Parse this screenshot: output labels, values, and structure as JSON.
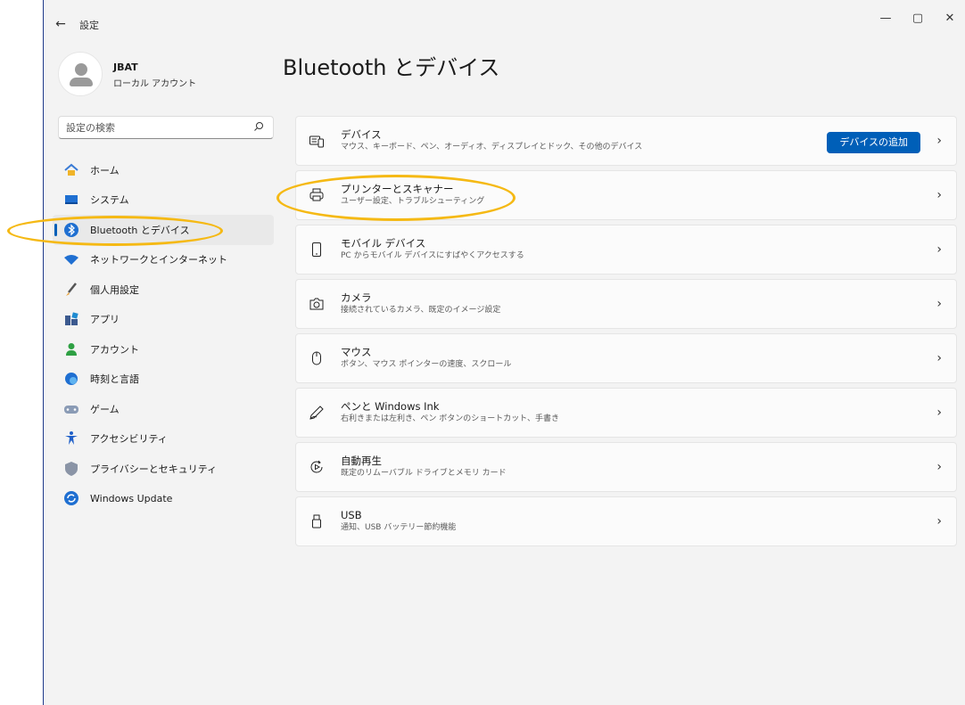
{
  "window": {
    "title": "設定",
    "controls": {
      "minimize": "—",
      "maximize": "▢",
      "close": "✕"
    }
  },
  "profile": {
    "name": "JBAT",
    "account_type": "ローカル アカウント"
  },
  "search": {
    "placeholder": "設定の検索"
  },
  "sidebar": {
    "items": [
      {
        "label": "ホーム",
        "icon": "home-icon",
        "active": false
      },
      {
        "label": "システム",
        "icon": "monitor-icon",
        "active": false
      },
      {
        "label": "Bluetooth とデバイス",
        "icon": "bluetooth-icon",
        "active": true
      },
      {
        "label": "ネットワークとインターネット",
        "icon": "wifi-icon",
        "active": false
      },
      {
        "label": "個人用設定",
        "icon": "brush-icon",
        "active": false
      },
      {
        "label": "アプリ",
        "icon": "apps-icon",
        "active": false
      },
      {
        "label": "アカウント",
        "icon": "person-icon",
        "active": false
      },
      {
        "label": "時刻と言語",
        "icon": "globe-clock-icon",
        "active": false
      },
      {
        "label": "ゲーム",
        "icon": "gamepad-icon",
        "active": false
      },
      {
        "label": "アクセシビリティ",
        "icon": "accessibility-icon",
        "active": false
      },
      {
        "label": "プライバシーとセキュリティ",
        "icon": "shield-icon",
        "active": false
      },
      {
        "label": "Windows Update",
        "icon": "update-icon",
        "active": false
      }
    ]
  },
  "main": {
    "title": "Bluetooth とデバイス",
    "cards": [
      {
        "title": "デバイス",
        "desc": "マウス、キーボード、ペン、オーディオ、ディスプレイとドック、その他のデバイス",
        "icon": "keyboard-icon",
        "button": "デバイスの追加"
      },
      {
        "title": "プリンターとスキャナー",
        "desc": "ユーザー設定、トラブルシューティング",
        "icon": "printer-icon"
      },
      {
        "title": "モバイル デバイス",
        "desc": "PC からモバイル デバイスにすばやくアクセスする",
        "icon": "phone-icon"
      },
      {
        "title": "カメラ",
        "desc": "接続されているカメラ、既定のイメージ設定",
        "icon": "camera-icon"
      },
      {
        "title": "マウス",
        "desc": "ボタン、マウス ポインターの速度、スクロール",
        "icon": "mouse-icon"
      },
      {
        "title": "ペンと Windows Ink",
        "desc": "右利きまたは左利き、ペン ボタンのショートカット、手書き",
        "icon": "pen-icon"
      },
      {
        "title": "自動再生",
        "desc": "既定のリムーバブル ドライブとメモリ カード",
        "icon": "autoplay-icon"
      },
      {
        "title": "USB",
        "desc": "通知、USB バッテリー節約機能",
        "icon": "usb-icon"
      }
    ]
  },
  "colors": {
    "accent": "#005fb8",
    "annotation": "#f5b914"
  }
}
